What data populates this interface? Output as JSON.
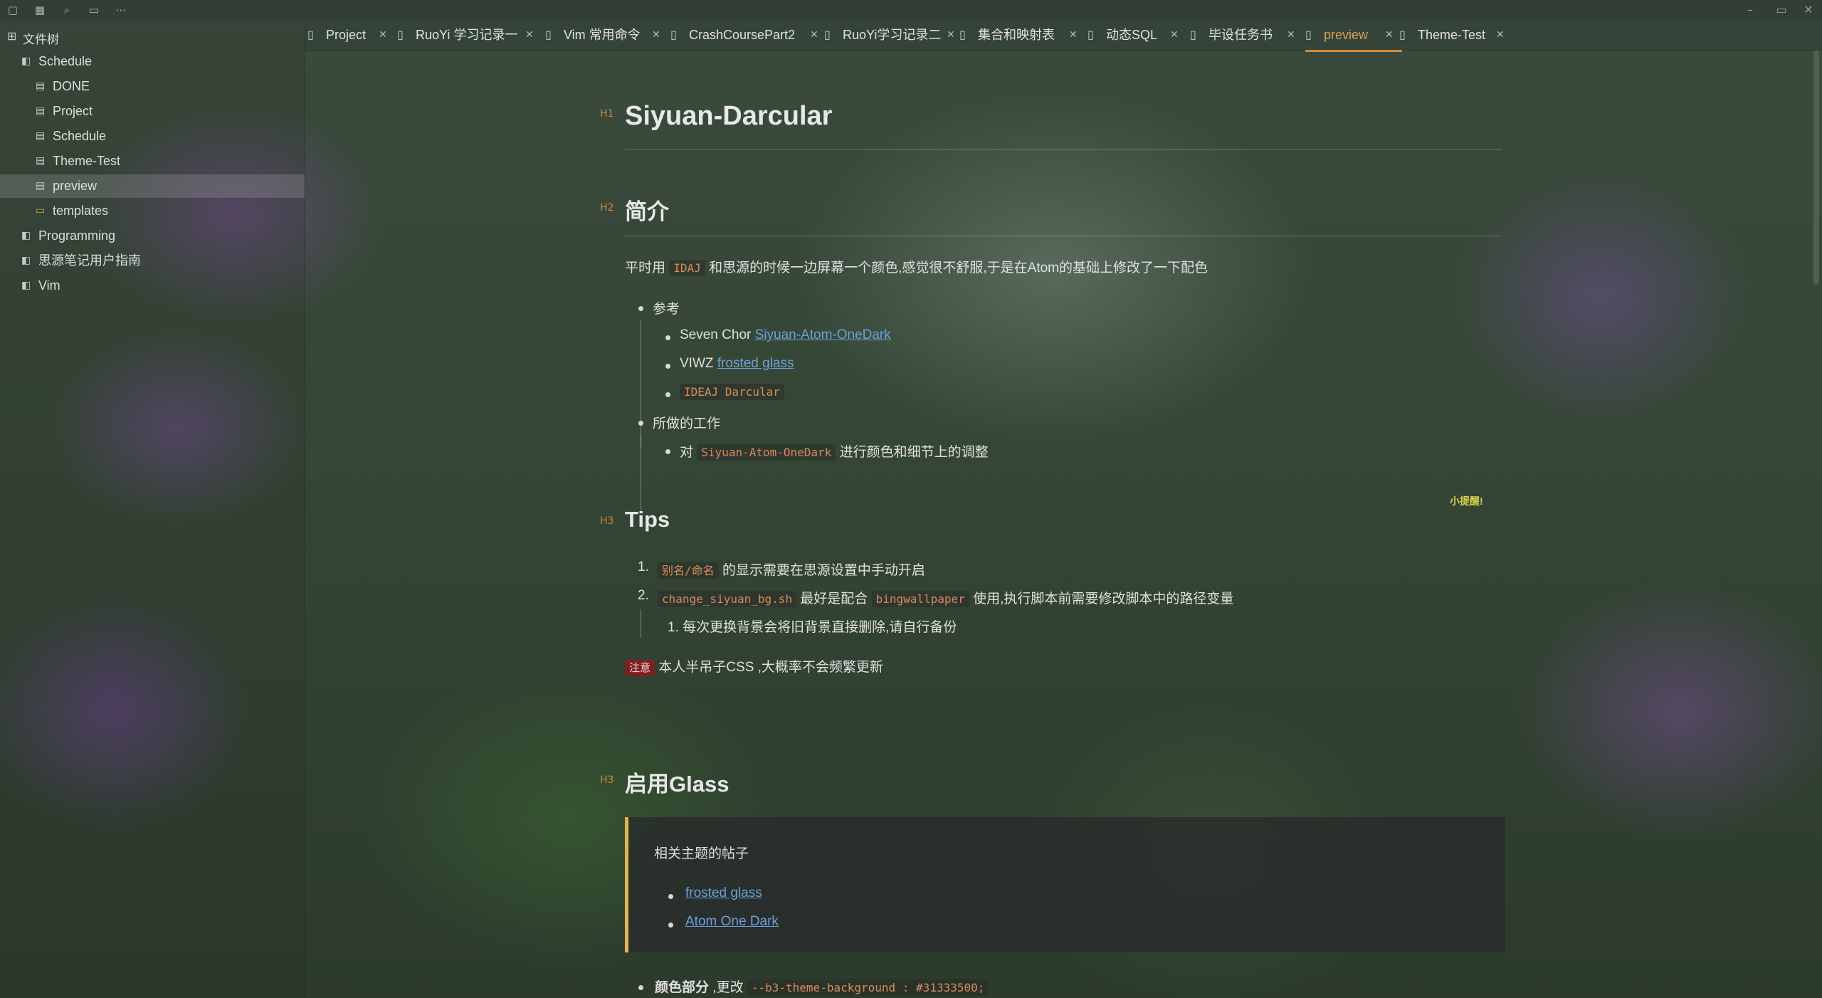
{
  "toolbar": {
    "icons": [
      "file-icon",
      "calendar-icon",
      "search-icon",
      "window-icon",
      "more-icon"
    ],
    "window_controls": [
      "minimize",
      "maximize",
      "close"
    ]
  },
  "sidebar": {
    "title": "文件树",
    "items": [
      {
        "label": "Schedule",
        "icon": "notebook-icon",
        "level": 0
      },
      {
        "label": "DONE",
        "icon": "doc-icon",
        "level": 1
      },
      {
        "label": "Project",
        "icon": "doc-icon",
        "level": 1
      },
      {
        "label": "Schedule",
        "icon": "doc-icon",
        "level": 1
      },
      {
        "label": "Theme-Test",
        "icon": "doc-icon",
        "level": 1
      },
      {
        "label": "preview",
        "icon": "doc-icon",
        "level": 1,
        "selected": true
      },
      {
        "label": "templates",
        "icon": "folder-icon",
        "level": 1
      },
      {
        "label": "Programming",
        "icon": "notebook-icon",
        "level": 0
      },
      {
        "label": "思源笔记用户指南",
        "icon": "notebook-icon",
        "level": 0
      },
      {
        "label": "Vim",
        "icon": "notebook-icon",
        "level": 0
      }
    ]
  },
  "tabs": [
    {
      "label": "Project"
    },
    {
      "label": "RuoYi 学习记录一"
    },
    {
      "label": "Vim 常用命令"
    },
    {
      "label": "CrashCoursePart2"
    },
    {
      "label": "RuoYi学习记录二"
    },
    {
      "label": "集合和映射表"
    },
    {
      "label": "动态SQL"
    },
    {
      "label": "毕设任务书"
    },
    {
      "label": "preview",
      "active": true
    },
    {
      "label": "Theme-Test"
    }
  ],
  "doc": {
    "h1": "Siyuan-Darcular",
    "h1_mark": "H1",
    "intro": {
      "heading": "简介",
      "mark": "H2",
      "p_pre": "平时用 ",
      "p_code": "IDAJ",
      "p_post": " 和思源的时候一边屏幕一个颜色,感觉很不舒服,于是在Atom的基础上修改了一下配色",
      "ref_label": "参考",
      "ref1_pre": "Seven Chor ",
      "ref1_link": "Siyuan-Atom-OneDark",
      "ref2_pre": "VIWZ ",
      "ref2_link": "frosted glass",
      "ref3_code": "IDEAJ Darcular",
      "work_label": "所做的工作",
      "work1_pre": "对 ",
      "work1_code": "Siyuan-Atom-OneDark",
      "work1_post": " 进行颜色和细节上的调整"
    },
    "hint": "小提醒!",
    "tips": {
      "heading": "Tips",
      "mark": "H3",
      "item1_num": "1.",
      "item1_code": "别名/命名",
      "item1_post": " 的显示需要在思源设置中手动开启",
      "item2_num": "2.",
      "item2_code": "change_siyuan_bg.sh",
      "item2_mid": " 最好是配合 ",
      "item2_code2": "bingwallpaper",
      "item2_post": " 使用,执行脚本前需要修改脚本中的路径变量",
      "item2_sub": "1. 每次更换背景会将旧背景直接删除,请自行备份",
      "note_tag": "注意",
      "note_text": " 本人半吊子CSS ,大概率不会频繁更新"
    },
    "glass": {
      "heading": "启用Glass",
      "mark": "H3",
      "quote_title": "相关主题的帖子",
      "quote_link1": "frosted glass",
      "quote_link2": "Atom One Dark",
      "color_bold": "颜色部分",
      "color_mid": " ,更改 ",
      "color_code": "--b3-theme-background : #31333500;"
    }
  }
}
